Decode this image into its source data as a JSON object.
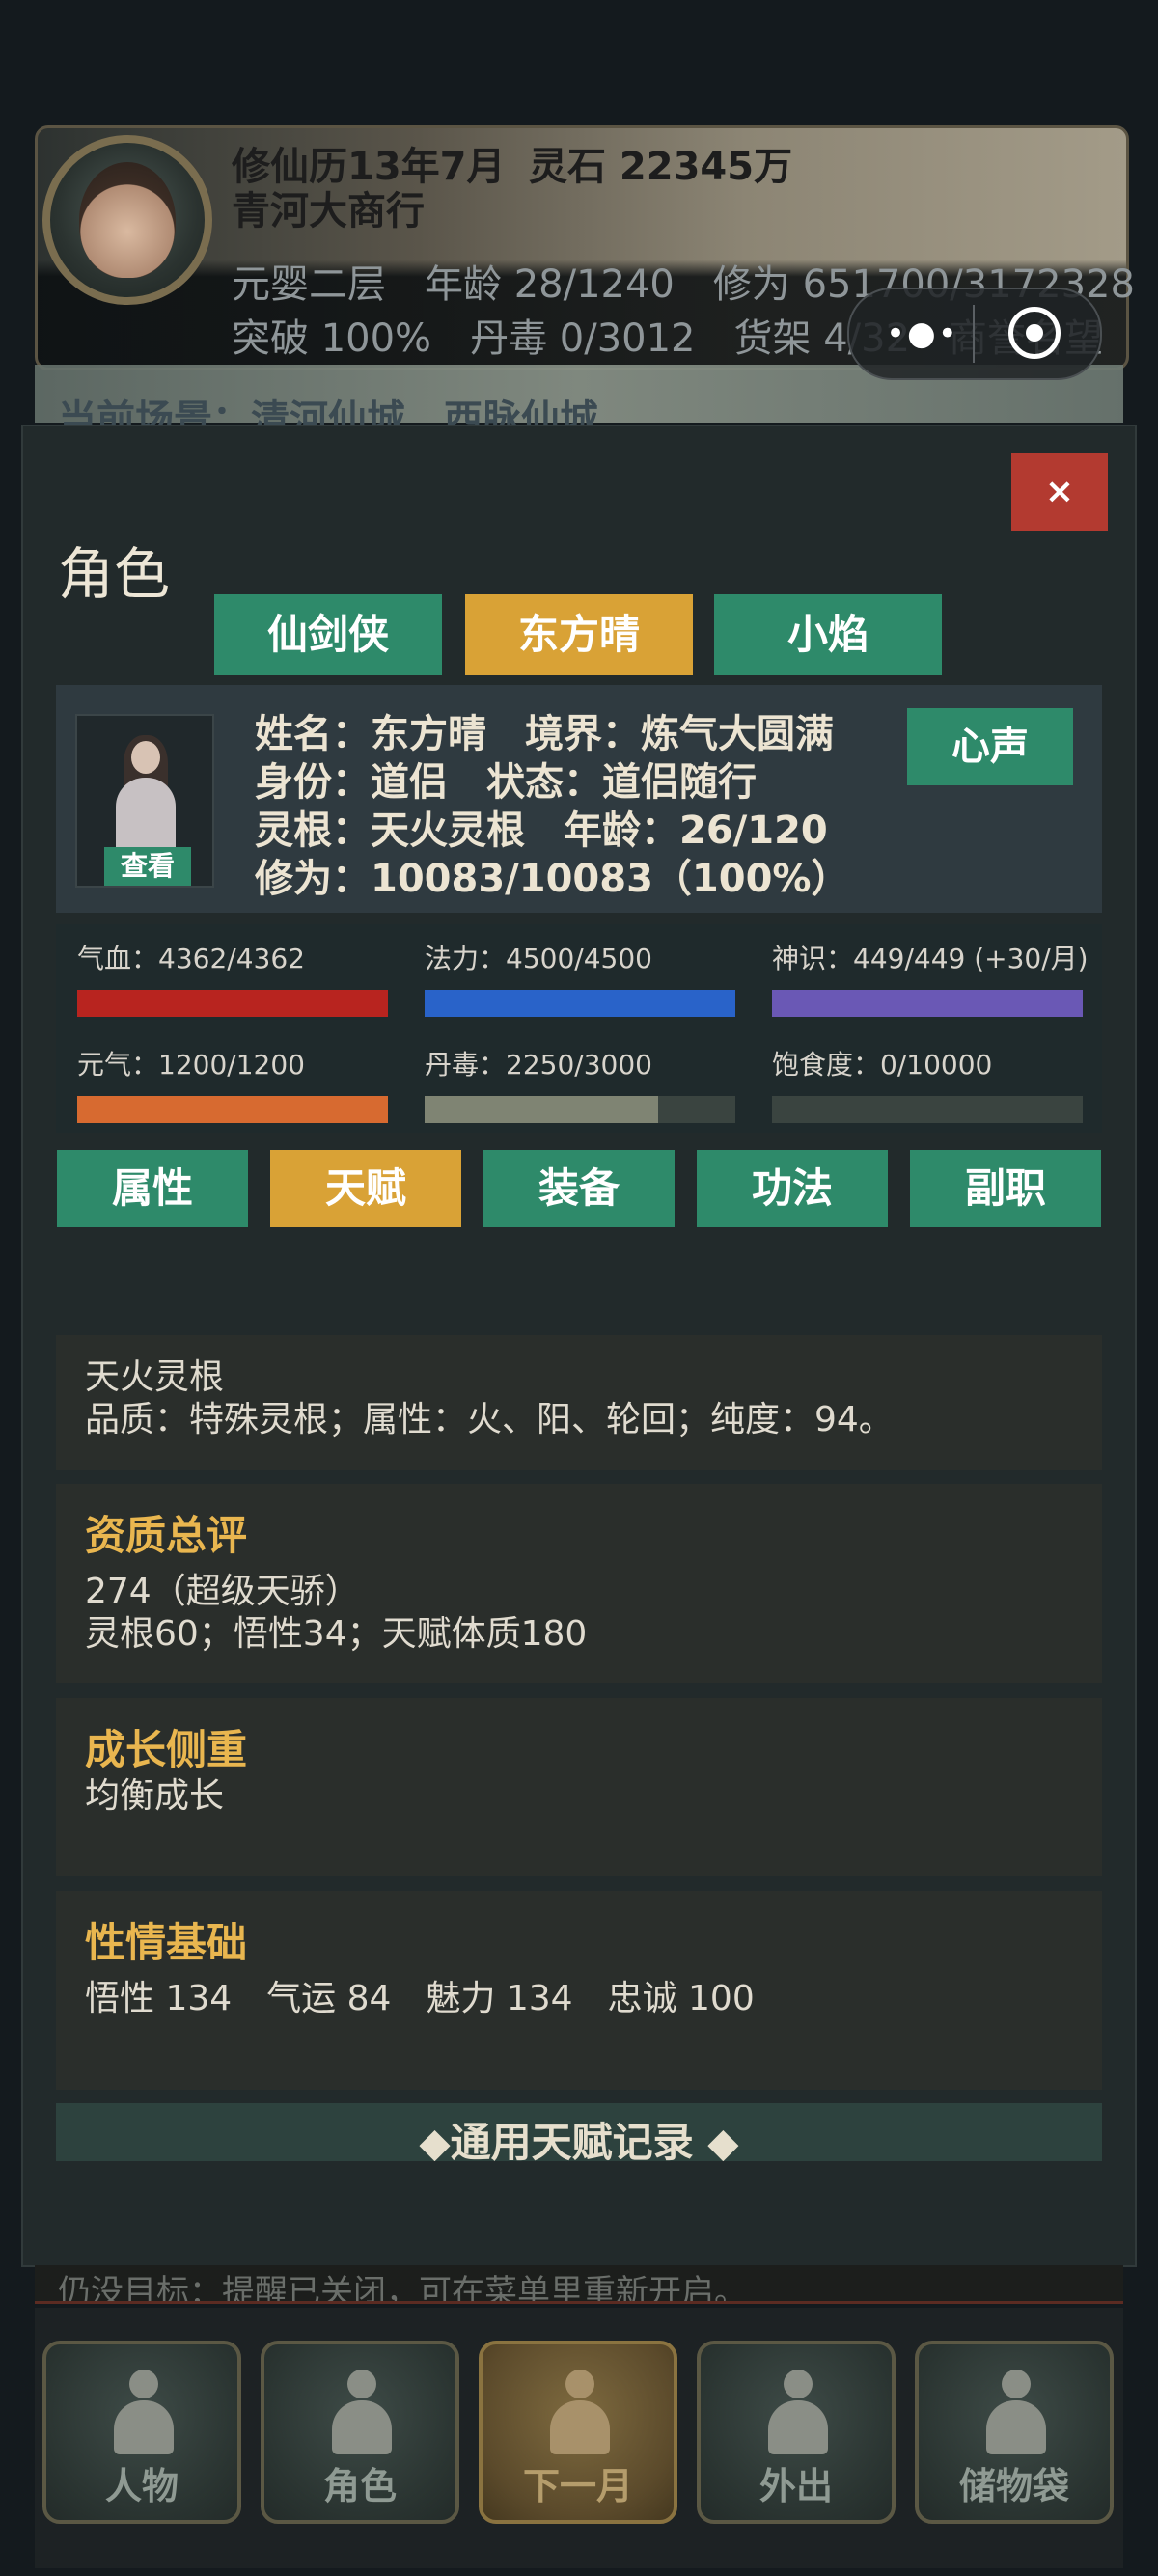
{
  "header": {
    "calendar": "修仙历13年7月",
    "spirit_stone": "灵石 22345万",
    "shop_name": "青河大商行",
    "stats_row1": "元婴二层　年龄 28/1240　修为 651700/3172328",
    "stats_row2": "突破 100%　丹毒 0/3012　货架 4/32　商誉名望",
    "scene": "当前场景：清河仙城　西脉仙城"
  },
  "capsule": {
    "more_icon": "more-dots-icon",
    "close_icon": "target-icon"
  },
  "modal": {
    "close_label": "×",
    "title": "角色",
    "character_tabs": [
      {
        "label": "仙剑侠",
        "active": false
      },
      {
        "label": "东方晴",
        "active": true
      },
      {
        "label": "小焰",
        "active": false
      }
    ],
    "info": {
      "line1": "姓名：东方晴　境界：炼气大圆满",
      "line2": "身份：道侣　状态：道侣随行",
      "line3": "灵根：天火灵根　年龄：26/120",
      "line4": "修为：10083/10083（100%）",
      "view_label": "查看",
      "heart_label": "心声"
    },
    "stats": [
      {
        "label": "气血：4362/4362",
        "fill": 1.0,
        "color": "#b8241f"
      },
      {
        "label": "法力：4500/4500",
        "fill": 1.0,
        "color": "#2963c9"
      },
      {
        "label": "神识：449/449 (+30/月)",
        "fill": 1.0,
        "color": "#6a58b5"
      },
      {
        "label": "元气：1200/1200",
        "fill": 1.0,
        "color": "#d76a30"
      },
      {
        "label": "丹毒：2250/3000",
        "fill": 0.75,
        "color": "#7f8473"
      },
      {
        "label": "饱食度：0/10000",
        "fill": 0.0,
        "color": "#7f8473"
      }
    ],
    "sub_tabs": [
      {
        "label": "属性",
        "active": false
      },
      {
        "label": "天赋",
        "active": true
      },
      {
        "label": "装备",
        "active": false
      },
      {
        "label": "功法",
        "active": false
      },
      {
        "label": "副职",
        "active": false
      }
    ],
    "talent": {
      "root_name": "天火灵根",
      "root_desc": "品质：特殊灵根；属性：火、阳、轮回；纯度：94。"
    },
    "aptitude": {
      "title": "资质总评",
      "score": "274（超级天骄）",
      "breakdown": "灵根60；悟性34；天赋体质180"
    },
    "growth": {
      "title": "成长侧重",
      "value": "均衡成长"
    },
    "temperament": {
      "title": "性情基础",
      "value": "悟性 134　气运 84　魅力 134　忠诚 100"
    },
    "record_label": "◆通用天赋记录 ◆"
  },
  "bottom_message": "仍没目标：提醒已关闭，可在菜单里重新开启。",
  "bottom_nav": [
    {
      "label": "人物",
      "active": false
    },
    {
      "label": "角色",
      "active": false
    },
    {
      "label": "下一月",
      "active": true
    },
    {
      "label": "外出",
      "active": false
    },
    {
      "label": "储物袋",
      "active": false
    }
  ]
}
